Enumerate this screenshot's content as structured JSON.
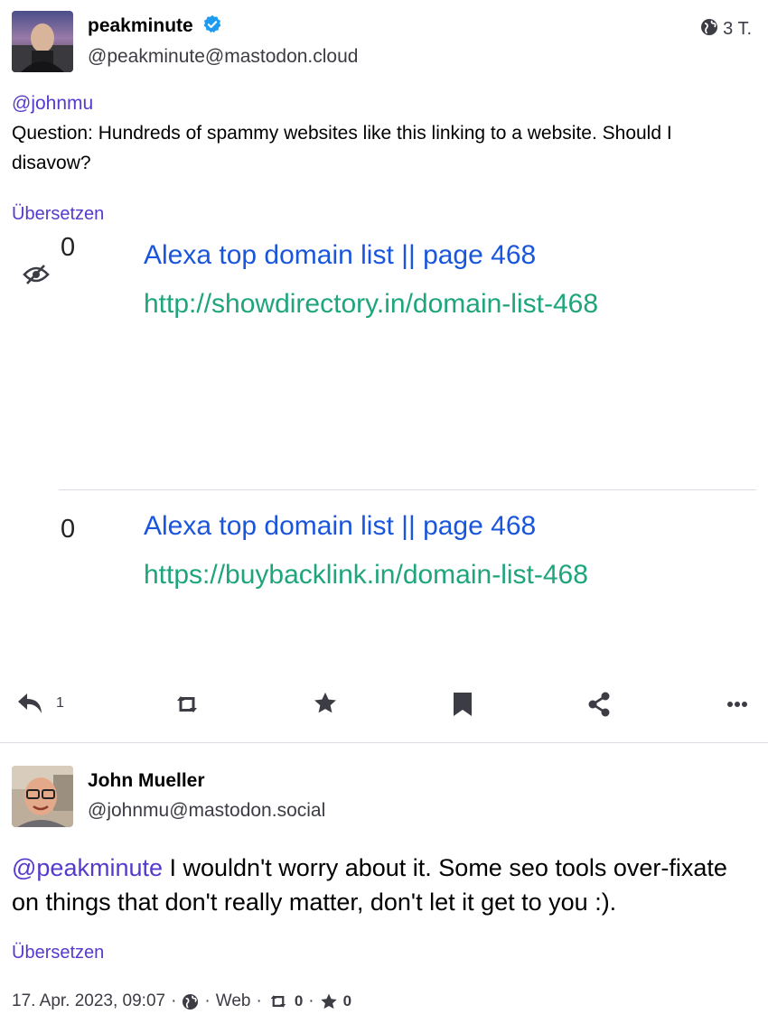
{
  "post1": {
    "display_name": "peakminute",
    "handle": "@peakminute@mastodon.cloud",
    "age": "3 T.",
    "mention": "@johnmu",
    "text": "Question: Hundreds of spammy websites like this linking to a website. Should I disavow?",
    "translate": "Übersetzen",
    "attachment": {
      "rows": [
        {
          "num": "0",
          "title": "Alexa top domain list || page 468",
          "url": "http://showdirectory.in/domain-list-468"
        },
        {
          "num": "0",
          "title": "Alexa top domain list || page 468",
          "url": "https://buybacklink.in/domain-list-468"
        }
      ]
    },
    "actions": {
      "reply_count": "1"
    }
  },
  "post2": {
    "display_name": "John Mueller",
    "handle": "@johnmu@mastodon.social",
    "mention": "@peakminute",
    "text": " I wouldn't worry about it. Some seo tools over-fixate on things that don't really matter, don't let it get to you :).",
    "translate": "Übersetzen",
    "meta": {
      "date": "17. Apr. 2023, 09:07",
      "sep": "·",
      "client": "Web",
      "boosts": "0",
      "favourites": "0"
    }
  },
  "colors": {
    "link": "#563acc",
    "verified": "#1d9bf0",
    "attachment_title": "#1a56db",
    "attachment_url": "#1ea57b"
  }
}
